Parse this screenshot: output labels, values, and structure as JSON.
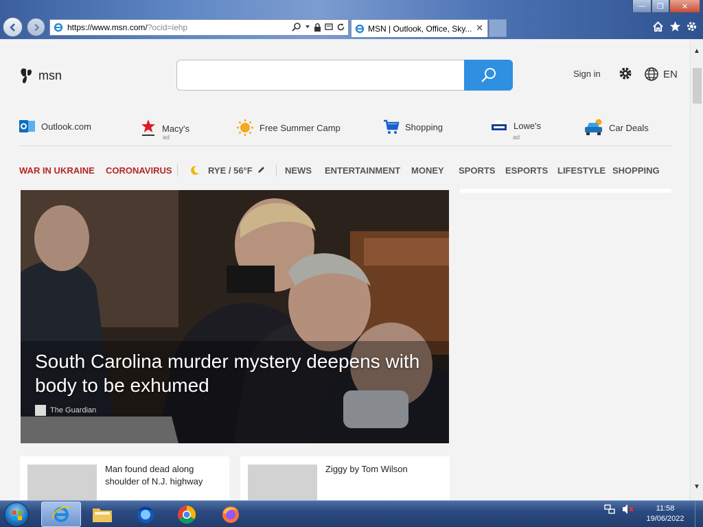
{
  "browser": {
    "address": {
      "host": "https://www.msn.com/",
      "rest": "?ocid=iehp"
    },
    "tab": {
      "title": "MSN | Outlook, Office, Sky...",
      "close": "✕"
    },
    "window_controls": {
      "minimize": "—",
      "maximize": "❐",
      "close": "✕"
    }
  },
  "header": {
    "logo_text": "msn",
    "search_placeholder": "",
    "sign_in": "Sign in",
    "language": "EN"
  },
  "quick_links": [
    {
      "label": "Outlook.com",
      "icon": "outlook-icon",
      "ad": ""
    },
    {
      "label": "Macy's",
      "icon": "macys-star-icon",
      "ad": "ad"
    },
    {
      "label": "Free Summer Camp",
      "icon": "sun-icon",
      "ad": ""
    },
    {
      "label": "Shopping",
      "icon": "cart-icon",
      "ad": ""
    },
    {
      "label": "Lowe's",
      "icon": "lowes-logo-icon",
      "ad": "ad"
    },
    {
      "label": "Car Deals",
      "icon": "car-icon",
      "ad": ""
    }
  ],
  "nav": {
    "war_in_ukraine": "WAR IN UKRAINE",
    "coronavirus": "CORONAVIRUS",
    "weather": "RYE / 56°F",
    "news": "NEWS",
    "entertainment": "ENTERTAINMENT",
    "money": "MONEY",
    "sports": "SPORTS",
    "esports": "ESPORTS",
    "lifestyle": "LIFESTYLE",
    "shopping": "SHOPPING"
  },
  "hero": {
    "title": "South Carolina murder mystery deepens with body to be exhumed",
    "source": "The Guardian"
  },
  "cards": [
    {
      "title": "Man found dead along shoulder of N.J. highway"
    },
    {
      "title": "Ziggy by Tom Wilson"
    }
  ],
  "taskbar": {
    "apps": [
      "internet-explorer",
      "file-explorer",
      "firefox-developer",
      "chrome",
      "firefox"
    ],
    "time": "11:58",
    "date": "19/06/2022"
  },
  "colors": {
    "accent": "#2f8fe0",
    "nav_red": "#b52525",
    "page_bg": "#f3f3f3"
  }
}
